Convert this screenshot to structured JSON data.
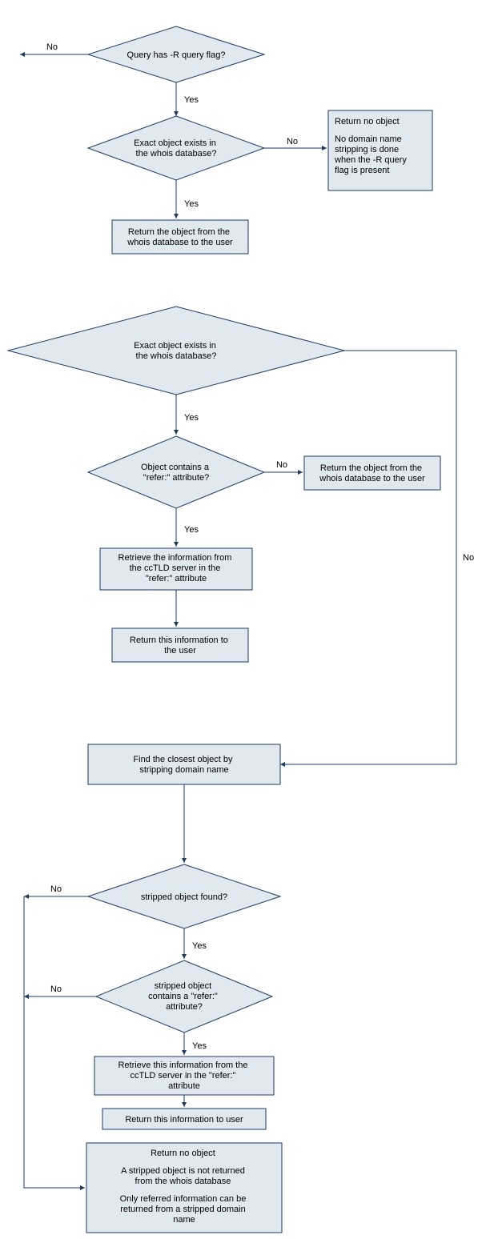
{
  "chart_data": {
    "type": "flowchart",
    "nodes": [
      {
        "id": "d1",
        "type": "decision",
        "text": "Query has -R query flag?"
      },
      {
        "id": "d2",
        "type": "decision",
        "text": "Exact object exists in the whois database?"
      },
      {
        "id": "p1",
        "type": "process",
        "text": "Return no object\n\nNo domain name stripping is done when the -R query flag is present"
      },
      {
        "id": "p2",
        "type": "process",
        "text": "Return the object from the whois database to the user"
      },
      {
        "id": "d3",
        "type": "decision",
        "text": "Exact object exists in the whois database?"
      },
      {
        "id": "d4",
        "type": "decision",
        "text": "Object contains a \"refer:\" attribute?"
      },
      {
        "id": "p3",
        "type": "process",
        "text": "Return the object from the whois database to the user"
      },
      {
        "id": "p4",
        "type": "process",
        "text": "Retrieve the information from the ccTLD server in the \"refer:\" attribute"
      },
      {
        "id": "p5",
        "type": "process",
        "text": "Return this information to the user"
      },
      {
        "id": "p6",
        "type": "process",
        "text": "Find the closest object by stripping domain name"
      },
      {
        "id": "d5",
        "type": "decision",
        "text": "stripped object found?"
      },
      {
        "id": "d6",
        "type": "decision",
        "text": "stripped object contains a \"refer:\" attribute?"
      },
      {
        "id": "p7",
        "type": "process",
        "text": "Retrieve this information from the ccTLD server in the \"refer:\" attribute"
      },
      {
        "id": "p8",
        "type": "process",
        "text": "Return this information to user"
      },
      {
        "id": "p9",
        "type": "process",
        "text": "Return no object\n\nA stripped object is not returned from the whois database\n\nOnly referred information can be returned from a stripped domain name"
      }
    ],
    "edges": [
      {
        "from": "d1",
        "to": "d2",
        "label": "Yes"
      },
      {
        "from": "d1",
        "to": null,
        "label": "No"
      },
      {
        "from": "d2",
        "to": "p1",
        "label": "No"
      },
      {
        "from": "d2",
        "to": "p2",
        "label": "Yes"
      },
      {
        "from": "d3",
        "to": "d4",
        "label": "Yes"
      },
      {
        "from": "d3",
        "to": "p6",
        "label": "No"
      },
      {
        "from": "d4",
        "to": "p3",
        "label": "No"
      },
      {
        "from": "d4",
        "to": "p4",
        "label": "Yes"
      },
      {
        "from": "p4",
        "to": "p5",
        "label": ""
      },
      {
        "from": "p6",
        "to": "d5",
        "label": ""
      },
      {
        "from": "d5",
        "to": "d6",
        "label": "Yes"
      },
      {
        "from": "d5",
        "to": "p9",
        "label": "No"
      },
      {
        "from": "d6",
        "to": "p7",
        "label": "Yes"
      },
      {
        "from": "d6",
        "to": "p9",
        "label": "No"
      },
      {
        "from": "p7",
        "to": "p8",
        "label": ""
      }
    ]
  },
  "labels": {
    "yes": "Yes",
    "no": "No"
  },
  "d1": "Query has -R query flag?",
  "d2": {
    "l1": "Exact object exists in",
    "l2": "the whois database?"
  },
  "d3": {
    "l1": "Exact object exists in",
    "l2": "the whois database?"
  },
  "d4": {
    "l1": "Object contains a",
    "l2": "\"refer:\" attribute?"
  },
  "d5": "stripped object found?",
  "d6": {
    "l1": "stripped object",
    "l2": "contains a \"refer:\"",
    "l3": "attribute?"
  },
  "p1": {
    "l1": "Return no object",
    "l2": "No domain name",
    "l3": "stripping is done",
    "l4": "when the -R query",
    "l5": "flag is present"
  },
  "p2": {
    "l1": "Return the object from the",
    "l2": "whois database to the user"
  },
  "p3": {
    "l1": "Return the object from the",
    "l2": "whois database to the user"
  },
  "p4": {
    "l1": "Retrieve the information from",
    "l2": "the ccTLD server in the",
    "l3": "\"refer:\" attribute"
  },
  "p5": {
    "l1": "Return this information to",
    "l2": "the user"
  },
  "p6": {
    "l1": "Find the closest object by",
    "l2": "stripping domain name"
  },
  "p7": {
    "l1": "Retrieve this information from the",
    "l2": "ccTLD server in the \"refer:\"",
    "l3": "attribute"
  },
  "p8": "Return this information to user",
  "p9": {
    "l1": "Return no object",
    "l2": "A stripped object is not returned",
    "l3": "from the whois database",
    "l4": "Only referred information can be",
    "l5": "returned from a stripped domain",
    "l6": "name"
  }
}
